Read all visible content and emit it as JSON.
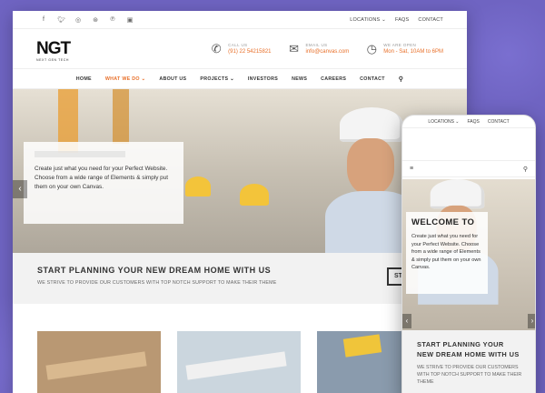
{
  "topbar": {
    "socials": [
      "f-icon",
      "twitter-icon",
      "instagram-icon",
      "dribbble-icon",
      "pinterest-icon",
      "instagram-icon"
    ],
    "links": [
      "LOCATIONS ⌄",
      "FAQS",
      "CONTACT"
    ]
  },
  "brand": {
    "logo": "NGT",
    "tagline": "NEXT GEN TECH"
  },
  "contact_info": [
    {
      "label": "CALL US",
      "value": "(91) 22 54215821",
      "icon": "phone-icon"
    },
    {
      "label": "EMAIL US",
      "value": "info@canvas.com",
      "icon": "email-icon"
    },
    {
      "label": "WE ARE OPEN",
      "value": "Mon - Sat, 10AM to 6PM",
      "icon": "clock-icon"
    }
  ],
  "nav": [
    "HOME",
    "WHAT WE DO ⌄",
    "ABOUT US",
    "PROJECTS ⌄",
    "INVESTORS",
    "NEWS",
    "CAREERS",
    "CONTACT"
  ],
  "hero": {
    "text": "Create just what you need for your Perfect Website. Choose from a wide range of Elements & simply put them on your own Canvas."
  },
  "band": {
    "title": "START PLANNING YOUR NEW DREAM HOME WITH US",
    "subtitle": "WE STRIVE TO PROVIDE OUR CUSTOMERS WITH TOP NOTCH SUPPORT TO MAKE THEIR THEME",
    "cta": "ST"
  },
  "mobile": {
    "links": [
      "LOCATIONS ⌄",
      "FAQS",
      "CONTACT"
    ],
    "hero_title": "WELCOME TO",
    "hero_text": "Create just what you need for your Perfect Website. Choose from a wide range of Elements & simply put them on your own Canvas.",
    "band_title": "START PLANNING YOUR NEW DREAM HOME WITH US",
    "band_text": "WE STRIVE TO PROVIDE OUR CUSTOMERS WITH TOP NOTCH SUPPORT TO MAKE THEIR THEME"
  },
  "colors": {
    "accent": "#e8702a",
    "background": "#6f64c2"
  }
}
